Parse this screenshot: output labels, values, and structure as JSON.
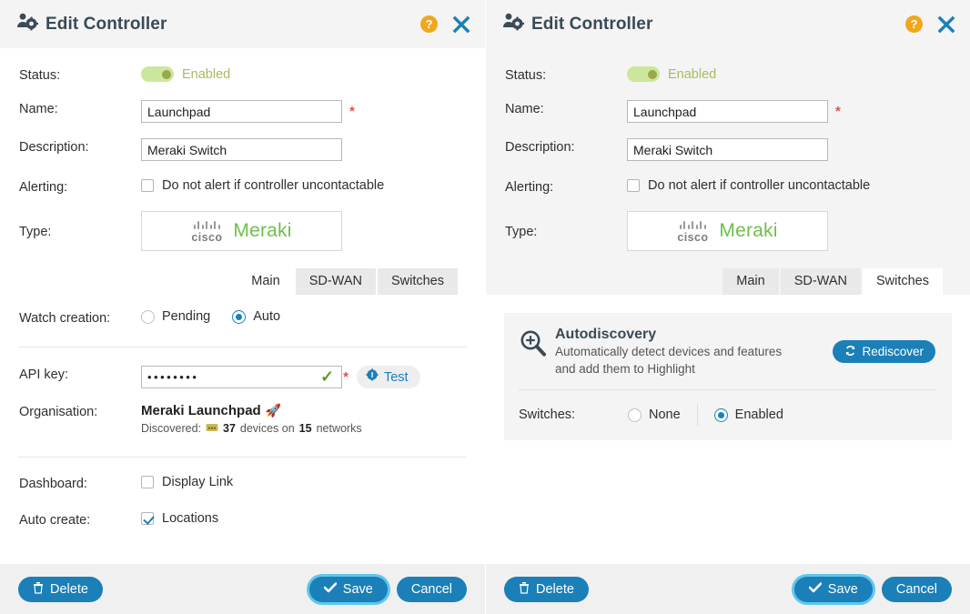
{
  "dialog": {
    "title": "Edit Controller",
    "title_icon": "user-gear-icon",
    "help_label": "?",
    "help_icon": "help-circle-icon",
    "close_icon": "close-x-icon"
  },
  "form": {
    "status": {
      "label": "Status:",
      "value": "Enabled",
      "toggle_on": true
    },
    "name": {
      "label": "Name:",
      "value": "Launchpad",
      "required": true
    },
    "description": {
      "label": "Description:",
      "value": "Meraki Switch"
    },
    "alerting": {
      "label": "Alerting:",
      "checkbox_label": "Do not alert if controller uncontactable",
      "checked": false
    },
    "type": {
      "label": "Type:",
      "brand_prefix": "cisco",
      "brand_name": "Meraki",
      "logo_icon": "cisco-meraki-logo"
    }
  },
  "tabs": {
    "items": [
      {
        "label": "Main"
      },
      {
        "label": "SD-WAN"
      },
      {
        "label": "Switches"
      }
    ],
    "left_active": "Main",
    "right_active": "Switches"
  },
  "main_tab": {
    "watch_creation": {
      "label": "Watch creation:",
      "options": [
        {
          "label": "Pending",
          "selected": false
        },
        {
          "label": "Auto",
          "selected": true
        }
      ]
    },
    "api_key": {
      "label": "API key:",
      "value": "••••••••",
      "valid_icon": "checkmark-icon",
      "required": true,
      "test_button": {
        "label": "Test",
        "icon": "gear-icon"
      }
    },
    "organisation": {
      "label": "Organisation:",
      "value": "Meraki Launchpad",
      "badge_icon": "rocket-icon",
      "discovered_prefix": "Discovered:",
      "discovered_icon": "device-icon",
      "device_count": "37",
      "devices_word": "devices on",
      "network_count": "15",
      "networks_word": "networks"
    },
    "dashboard": {
      "label": "Dashboard:",
      "checkbox_label": "Display Link",
      "checked": false
    },
    "auto_create": {
      "label": "Auto create:",
      "checkbox_label": "Locations",
      "checked": true
    }
  },
  "switches_tab": {
    "autodiscovery": {
      "icon": "magnifier-plus-icon",
      "title": "Autodiscovery",
      "subtitle_line1": "Automatically detect devices and features",
      "subtitle_line2": "and add them to Highlight",
      "rediscover_button": {
        "label": "Rediscover",
        "icon": "refresh-icon"
      }
    },
    "switches": {
      "label": "Switches:",
      "options": [
        {
          "label": "None",
          "selected": false
        },
        {
          "label": "Enabled",
          "selected": true
        }
      ]
    }
  },
  "footer": {
    "delete": {
      "label": "Delete",
      "icon": "trash-icon"
    },
    "save": {
      "label": "Save",
      "icon": "check-icon"
    },
    "cancel": {
      "label": "Cancel"
    }
  },
  "colors": {
    "accent_blue": "#1b7fb8",
    "toggle_green": "#cbe79b",
    "meraki_green": "#6fbf4a",
    "required_red": "#d9534f",
    "help_orange": "#f0a71c"
  }
}
